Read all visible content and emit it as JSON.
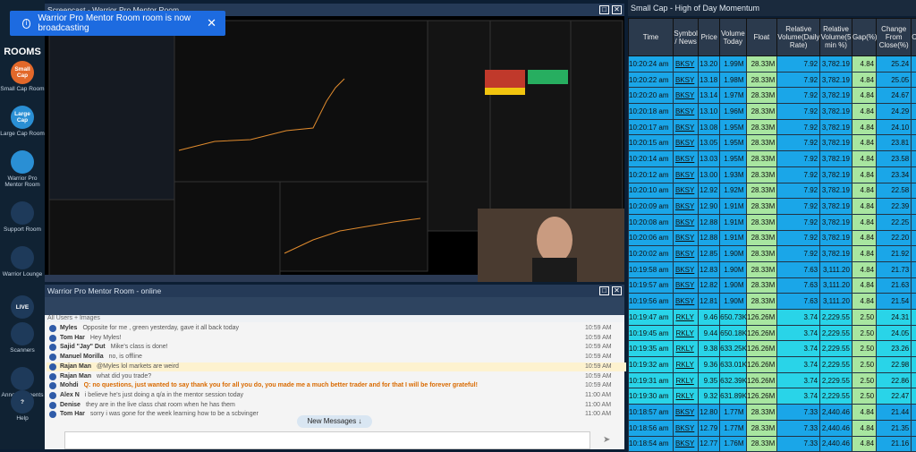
{
  "toast": {
    "text": "Warrior Pro Mentor Room room is now broadcasting",
    "close": "✕"
  },
  "sidebar": {
    "title": "ROOMS",
    "items": [
      {
        "circle": "Small Cap",
        "label": "Small Cap Room",
        "color": "#e2682a"
      },
      {
        "circle": "Large Cap",
        "label": "Large Cap Room",
        "color": "#2a8fd4"
      },
      {
        "circle": "",
        "label": "Warrior Pro Mentor Room",
        "color": "#2a8fd4"
      },
      {
        "circle": "",
        "label": "Support Room",
        "color": "#1e3a5a"
      },
      {
        "circle": "",
        "label": "Warrior Lounge",
        "color": "#1e3a5a"
      },
      {
        "circle": "LIVE",
        "label": "",
        "color": "#1e3a5a"
      },
      {
        "circle": "",
        "label": "Scanners",
        "color": "#1e3a5a"
      },
      {
        "circle": "",
        "label": "Announcements",
        "color": "#1e3a5a"
      },
      {
        "circle": "?",
        "label": "Help",
        "color": "#1e3a5a"
      }
    ]
  },
  "screencast": {
    "title": "Screencast - Warrior Pro Mentor Room"
  },
  "chat": {
    "title": "Warrior Pro Mentor Room - online",
    "filter": "All Users + Images",
    "new_messages": "New Messages ↓",
    "messages": [
      {
        "user": "Myles",
        "text": "Opposite for me , green yesterday, gave it all back today",
        "time": "10:59 AM",
        "style": ""
      },
      {
        "user": "Tom Har",
        "text": "Hey Myles!",
        "time": "10:59 AM",
        "style": ""
      },
      {
        "user": "Sajid \"Jay\" Dut",
        "text": "Mike's class is done!",
        "time": "10:59 AM",
        "style": ""
      },
      {
        "user": "Manuel Morilla",
        "text": "no, is offline",
        "time": "10:59 AM",
        "style": ""
      },
      {
        "user": "Rajan Man",
        "text": "@Myles lol markets are weird",
        "time": "10:59 AM",
        "style": "hl"
      },
      {
        "user": "Rajan Man",
        "text": "what did you trade?",
        "time": "10:59 AM",
        "style": ""
      },
      {
        "user": "Mohdi",
        "text": "Q: no questions, just wanted to say thank you for all you do, you made me a much better trader and for that I will be forever grateful!",
        "time": "10:59 AM",
        "style": "or"
      },
      {
        "user": "Alex N",
        "text": "i believe he's just doing a q/a in the mentor session today",
        "time": "11:00 AM",
        "style": ""
      },
      {
        "user": "Denise",
        "text": "they are in the live class chat room when he has them",
        "time": "11:00 AM",
        "style": ""
      },
      {
        "user": "Tom Har",
        "text": "sorry i was gone for the week learning how to be a scbvinger",
        "time": "11:00 AM",
        "style": ""
      }
    ]
  },
  "scanner": {
    "title": "Small Cap - High of Day Momentum",
    "headers": [
      "Time",
      "Symbol / News",
      "Price",
      "Volume Today",
      "Float",
      "Relative Volume(Daily Rate)",
      "Relative Volume(5 min %)",
      "Gap(%)",
      "Change From Close(%)",
      "Ch"
    ],
    "rows": [
      [
        "10:20:24 am",
        "BKSY",
        "13.20",
        "1.99M",
        "28.33M",
        "7.92",
        "3,782.19",
        "4.84",
        "25.24"
      ],
      [
        "10:20:22 am",
        "BKSY",
        "13.18",
        "1.98M",
        "28.33M",
        "7.92",
        "3,782.19",
        "4.84",
        "25.05"
      ],
      [
        "10:20:20 am",
        "BKSY",
        "13.14",
        "1.97M",
        "28.33M",
        "7.92",
        "3,782.19",
        "4.84",
        "24.67"
      ],
      [
        "10:20:18 am",
        "BKSY",
        "13.10",
        "1.96M",
        "28.33M",
        "7.92",
        "3,782.19",
        "4.84",
        "24.29"
      ],
      [
        "10:20:17 am",
        "BKSY",
        "13.08",
        "1.95M",
        "28.33M",
        "7.92",
        "3,782.19",
        "4.84",
        "24.10"
      ],
      [
        "10:20:15 am",
        "BKSY",
        "13.05",
        "1.95M",
        "28.33M",
        "7.92",
        "3,782.19",
        "4.84",
        "23.81"
      ],
      [
        "10:20:14 am",
        "BKSY",
        "13.03",
        "1.95M",
        "28.33M",
        "7.92",
        "3,782.19",
        "4.84",
        "23.58"
      ],
      [
        "10:20:12 am",
        "BKSY",
        "13.00",
        "1.93M",
        "28.33M",
        "7.92",
        "3,782.19",
        "4.84",
        "23.34"
      ],
      [
        "10:20:10 am",
        "BKSY",
        "12.92",
        "1.92M",
        "28.33M",
        "7.92",
        "3,782.19",
        "4.84",
        "22.58"
      ],
      [
        "10:20:09 am",
        "BKSY",
        "12.90",
        "1.91M",
        "28.33M",
        "7.92",
        "3,782.19",
        "4.84",
        "22.39"
      ],
      [
        "10:20:08 am",
        "BKSY",
        "12.88",
        "1.91M",
        "28.33M",
        "7.92",
        "3,782.19",
        "4.84",
        "22.25"
      ],
      [
        "10:20:06 am",
        "BKSY",
        "12.88",
        "1.91M",
        "28.33M",
        "7.92",
        "3,782.19",
        "4.84",
        "22.20"
      ],
      [
        "10:20:02 am",
        "BKSY",
        "12.85",
        "1.90M",
        "28.33M",
        "7.92",
        "3,782.19",
        "4.84",
        "21.92"
      ],
      [
        "10:19:58 am",
        "BKSY",
        "12.83",
        "1.90M",
        "28.33M",
        "7.63",
        "3,111.20",
        "4.84",
        "21.73"
      ],
      [
        "10:19:57 am",
        "BKSY",
        "12.82",
        "1.90M",
        "28.33M",
        "7.63",
        "3,111.20",
        "4.84",
        "21.63"
      ],
      [
        "10:19:56 am",
        "BKSY",
        "12.81",
        "1.90M",
        "28.33M",
        "7.63",
        "3,111.20",
        "4.84",
        "21.54"
      ],
      [
        "10:19:47 am",
        "RKLY",
        "9.46",
        "650.73K",
        "126.26M",
        "3.74",
        "2,229.55",
        "2.50",
        "24.31"
      ],
      [
        "10:19:45 am",
        "RKLY",
        "9.44",
        "650.18K",
        "126.26M",
        "3.74",
        "2,229.55",
        "2.50",
        "24.05"
      ],
      [
        "10:19:35 am",
        "RKLY",
        "9.38",
        "633.25K",
        "126.26M",
        "3.74",
        "2,229.55",
        "2.50",
        "23.26"
      ],
      [
        "10:19:32 am",
        "RKLY",
        "9.36",
        "633.01K",
        "126.26M",
        "3.74",
        "2,229.55",
        "2.50",
        "22.98"
      ],
      [
        "10:19:31 am",
        "RKLY",
        "9.35",
        "632.39K",
        "126.26M",
        "3.74",
        "2,229.55",
        "2.50",
        "22.86"
      ],
      [
        "10:19:30 am",
        "RKLY",
        "9.32",
        "631.89K",
        "126.26M",
        "3.74",
        "2,229.55",
        "2.50",
        "22.47"
      ],
      [
        "10:18:57 am",
        "BKSY",
        "12.80",
        "1.77M",
        "28.33M",
        "7.33",
        "2,440.46",
        "4.84",
        "21.44"
      ],
      [
        "10:18:56 am",
        "BKSY",
        "12.79",
        "1.77M",
        "28.33M",
        "7.33",
        "2,440.46",
        "4.84",
        "21.35"
      ],
      [
        "10:18:54 am",
        "BKSY",
        "12.77",
        "1.76M",
        "28.33M",
        "7.33",
        "2,440.46",
        "4.84",
        "21.16"
      ]
    ]
  },
  "colors": {
    "bksy_row": "#1aa6e8",
    "rkly_row": "#29d4e8",
    "green_cell": "#a8e6a0"
  }
}
